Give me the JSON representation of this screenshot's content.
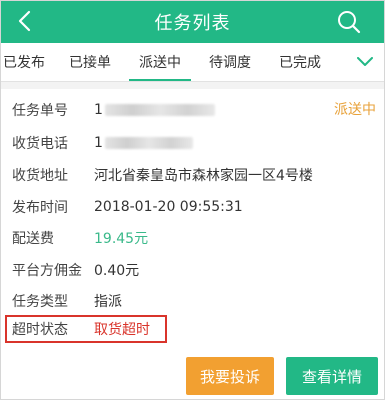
{
  "header": {
    "title": "任务列表",
    "back_icon": "chevron-left-icon",
    "search_icon": "search-icon"
  },
  "tabs": [
    {
      "label": "已发布",
      "active": false
    },
    {
      "label": "已接单",
      "active": false
    },
    {
      "label": "派送中",
      "active": true
    },
    {
      "label": "待调度",
      "active": false
    },
    {
      "label": "已完成",
      "active": false
    }
  ],
  "tabs_more_icon": "chevron-down-icon",
  "task": {
    "status": "派送中",
    "fields": {
      "task_no": {
        "label": "任务单号",
        "value_prefix": "1"
      },
      "phone": {
        "label": "收货电话",
        "value_prefix": "1"
      },
      "address": {
        "label": "收货地址",
        "value": "河北省秦皇岛市森林家园一区4号楼"
      },
      "publish_time": {
        "label": "发布时间",
        "value": "2018-01-20 09:55:31"
      },
      "delivery_fee": {
        "label": "配送费",
        "value": "19.45元"
      },
      "commission": {
        "label": "平台方佣金",
        "value": "0.40元"
      },
      "task_type": {
        "label": "任务类型",
        "value": "指派"
      },
      "overdue": {
        "label": "超时状态",
        "value": "取货超时"
      }
    }
  },
  "actions": {
    "complain": "我要投诉",
    "details": "查看详情"
  },
  "colors": {
    "brand": "#22b886",
    "status": "#e8a23a",
    "fee": "#3ab98a",
    "alert": "#d9342b",
    "complain_button": "#f2a031"
  }
}
